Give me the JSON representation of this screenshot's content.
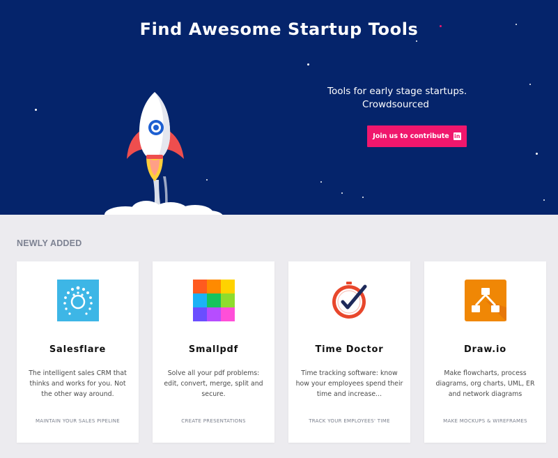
{
  "hero": {
    "title": "Find Awesome Startup Tools",
    "tagline_line1": "Tools for early stage startups.",
    "tagline_line2": "Crowdsourced",
    "cta_label": "Join us to contribute",
    "cta_icon": "linkedin-icon",
    "background_color": "#05246b",
    "cta_color": "#f0176d"
  },
  "section": {
    "title": "NEWLY ADDED"
  },
  "cards": [
    {
      "name": "Salesflare",
      "icon": "salesflare-logo",
      "description": "The intelligent sales CRM that thinks and works for you. Not the other way around.",
      "category": "MAINTAIN YOUR SALES PIPELINE",
      "color": "#3db6e6"
    },
    {
      "name": "Smallpdf",
      "icon": "smallpdf-logo",
      "description": "Solve all your pdf problems: edit, convert, merge, split and secure.",
      "category": "CREATE PRESENTATIONS",
      "color": "#ff5a1f"
    },
    {
      "name": "Time Doctor",
      "icon": "time-doctor-logo",
      "description": "Time tracking software: know how your employees spend their time and increase...",
      "category": "TRACK YOUR EMPLOYEES' TIME",
      "color": "#e8472c"
    },
    {
      "name": "Draw.io",
      "icon": "drawio-logo",
      "description": "Make flowcharts, process diagrams, org charts, UML, ER and network diagrams",
      "category": "MAKE MOCKUPS & WIREFRAMES",
      "color": "#f08705"
    }
  ]
}
